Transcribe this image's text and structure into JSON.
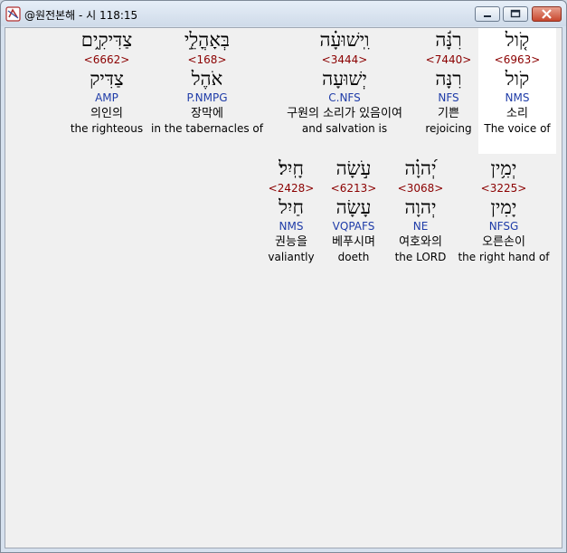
{
  "window": {
    "title": "@원전본해 - 시 118:15"
  },
  "row1": [
    {
      "hebrew": "קֹ֤ול",
      "strong": "<6963>",
      "lemma": "קֹול",
      "parse": "NMS",
      "korean": "소리",
      "english": "The voice of",
      "selected": true
    },
    {
      "hebrew": "רִנָּ֬ה",
      "strong": "<7440>",
      "lemma": "רִנָּה",
      "parse": "NFS",
      "korean": "기쁜",
      "english": "rejoicing",
      "selected": false
    },
    {
      "hebrew": "וִֽישׁוּעָ֗ה",
      "strong": "<3444>",
      "lemma": "יְשׁוּעָה",
      "parse": "C.NFS",
      "korean": "구원의 소리가 있음이여",
      "english": "and salvation is",
      "selected": false
    },
    {
      "hebrew": "בְּאָהֳלֵ֣י",
      "strong": "<168>",
      "lemma": "אֹהֶל",
      "parse": "P.NMPG",
      "korean": "장막에",
      "english": "in the tabernacles of",
      "selected": false
    },
    {
      "hebrew": "צַדִּיקִ֑ים",
      "strong": "<6662>",
      "lemma": "צַדִּיק",
      "parse": "AMP",
      "korean": "의인의",
      "english": "the righteous",
      "selected": false
    }
  ],
  "row2": [
    {
      "hebrew": "יְמִ֥ין",
      "strong": "<3225>",
      "lemma": "יָמִין",
      "parse": "NFSG",
      "korean": "오른손이",
      "english": "the right hand of",
      "selected": false
    },
    {
      "hebrew": "יְ֝הוָ֗ה",
      "strong": "<3068>",
      "lemma": "יְהוָה",
      "parse": "NE",
      "korean": "여호와의",
      "english": "the LORD",
      "selected": false
    },
    {
      "hebrew": "עֹ֣שָׂה",
      "strong": "<6213>",
      "lemma": "עָשָׂה",
      "parse": "VQPAFS",
      "korean": "베푸시며",
      "english": "doeth",
      "selected": false
    },
    {
      "hebrew": "חָֽיִל׃",
      "strong": "<2428>",
      "lemma": "חַיִל",
      "parse": "NMS",
      "korean": "권능을",
      "english": "valiantly",
      "selected": false
    }
  ]
}
